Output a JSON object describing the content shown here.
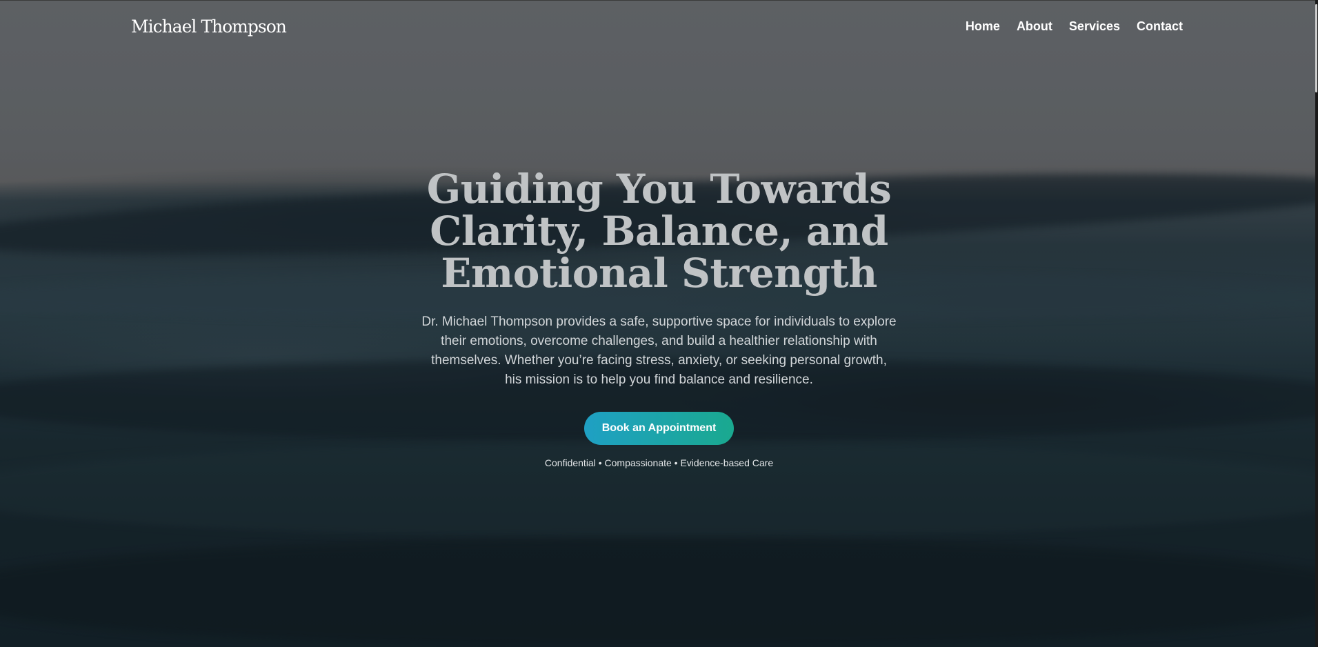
{
  "header": {
    "brand": "Michael Thompson",
    "nav": [
      {
        "label": "Home"
      },
      {
        "label": "About"
      },
      {
        "label": "Services"
      },
      {
        "label": "Contact"
      }
    ]
  },
  "hero": {
    "headline": "Guiding You Towards Clarity, Balance, and Emotional Strength",
    "description": "Dr. Michael Thompson provides a safe, supportive space for individuals to explore their emotions, overcome challenges, and build a healthier relationship with themselves. Whether you’re facing stress, anxiety, or seeking personal growth, his mission is to help you find balance and resilience.",
    "cta_label": "Book an Appointment",
    "tagline": "Confidential • Compassionate • Evidence-based Care"
  },
  "colors": {
    "cta_gradient_start": "#1fa0c4",
    "cta_gradient_end": "#1aa98f",
    "headline": "#c0c3c5"
  }
}
